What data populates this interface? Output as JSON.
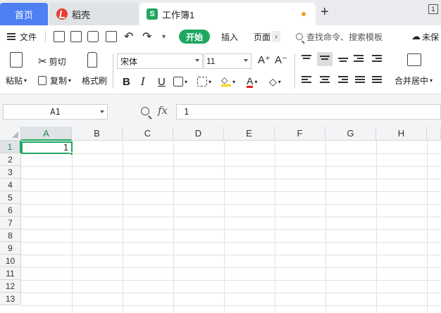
{
  "tabs": {
    "home": "首页",
    "daoke": "稻壳",
    "document": "工作簿1"
  },
  "window": {
    "counter": "1"
  },
  "menu": {
    "file": "文件",
    "start": "开始",
    "insert": "插入",
    "page": "页面",
    "search": "查找命令、搜索模板",
    "unsynced": "未保"
  },
  "ribbon": {
    "paste": "粘贴",
    "cut": "剪切",
    "copy": "复制",
    "format_painter": "格式刷",
    "font_name": "宋体",
    "font_size": "11",
    "merge_center": "合并居中",
    "bold": "B",
    "italic": "I",
    "underline": "U",
    "increase_font": "A⁺",
    "decrease_font": "A⁻"
  },
  "formula_bar": {
    "name_box": "A1",
    "fx": "fx",
    "value": "1"
  },
  "columns": [
    "A",
    "B",
    "C",
    "D",
    "E",
    "F",
    "G",
    "H"
  ],
  "rows": [
    "1",
    "2",
    "3",
    "4",
    "5",
    "6",
    "7",
    "8",
    "9",
    "10",
    "11",
    "12",
    "13"
  ],
  "cells": {
    "A1": "1"
  },
  "colors": {
    "accent_green": "#1fa761",
    "home_blue": "#4e7ff3",
    "logo_red": "#e63f33"
  }
}
